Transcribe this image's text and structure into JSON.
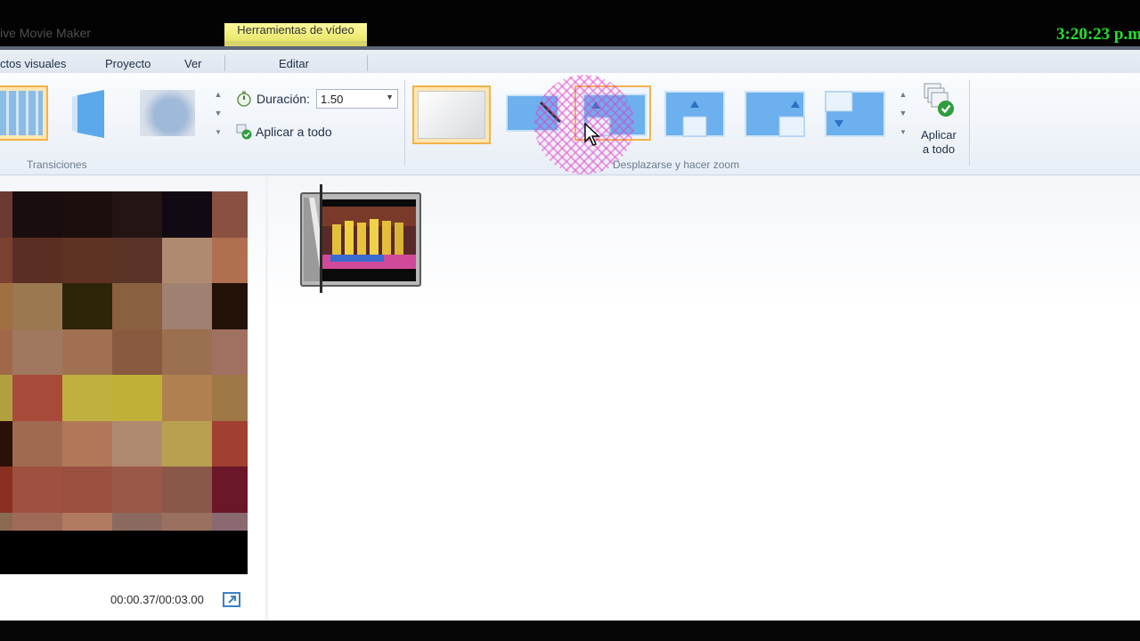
{
  "window": {
    "app_title": "ive Movie Maker",
    "context_tab": "Herramientas de vídeo",
    "clock": "3:20:23 p.m"
  },
  "tabs": [
    {
      "label": "ctos visuales"
    },
    {
      "label": "Proyecto"
    },
    {
      "label": "Ver"
    },
    {
      "label": "Editar"
    }
  ],
  "ribbon": {
    "transitions": {
      "group_label": "Transiciones",
      "duration_label": "Duración:",
      "duration_value": "1.50",
      "apply_all_label": "Aplicar a todo"
    },
    "pan_zoom": {
      "group_label": "Desplazarse y hacer zoom",
      "apply_all_line1": "Aplicar",
      "apply_all_line2": "a todo"
    }
  },
  "preview": {
    "time_readout": "00:00.37/00:03.00"
  },
  "colors": {
    "accent": "#f2b24d",
    "ribbon_blue": "#3a86d6",
    "clock_green": "#22e22a"
  },
  "mosaic_colors": [
    [
      "#6a3a33",
      "#1a0d0d",
      "#1d0e0e",
      "#241414",
      "#120a12",
      "#8a5040"
    ],
    [
      "#7a4030",
      "#5a2e22",
      "#5e3324",
      "#5a3426",
      "#b08a70",
      "#b07050"
    ],
    [
      "#a07040",
      "#9a7850",
      "#2e2408",
      "#8a6040",
      "#a08070",
      "#221208"
    ],
    [
      "#a06848",
      "#a07860",
      "#a07050",
      "#8a5a40",
      "#9a7050",
      "#a07060"
    ],
    [
      "#b0a040",
      "#a84a3a",
      "#c0b040",
      "#c0b038",
      "#b08050",
      "#a07848"
    ],
    [
      "#2a1008",
      "#a06a50",
      "#b07858",
      "#b08a70",
      "#b8a050",
      "#a04030"
    ],
    [
      "#8a3020",
      "#a05040",
      "#9a5040",
      "#9a5848",
      "#8a5848",
      "#6a1828"
    ],
    [
      "#8a6a50",
      "#a06a58",
      "#b07a60",
      "#8a6a60",
      "#9a7060",
      "#8a6a70"
    ]
  ]
}
